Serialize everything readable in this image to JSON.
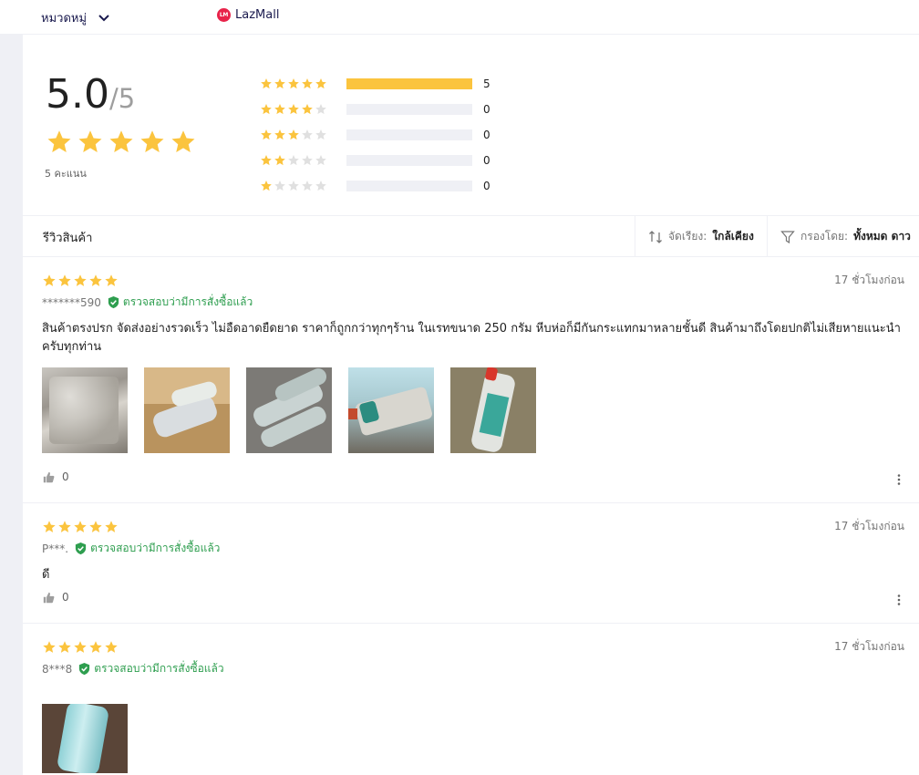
{
  "topbar": {
    "category_label": "หมวดหมู่",
    "lazmall_badge": "LM",
    "lazmall_label": "LazMall"
  },
  "summary": {
    "average": "5.0",
    "out_of": "/5",
    "rating_count": "5 คะแนน",
    "distribution": [
      {
        "stars": 5,
        "count": "5",
        "fraction": 1.0
      },
      {
        "stars": 4,
        "count": "0",
        "fraction": 0
      },
      {
        "stars": 3,
        "count": "0",
        "fraction": 0
      },
      {
        "stars": 2,
        "count": "0",
        "fraction": 0
      },
      {
        "stars": 1,
        "count": "0",
        "fraction": 0
      }
    ]
  },
  "reviews_header": {
    "title": "รีวิวสินค้า",
    "sort_label": "จัดเรียง:",
    "sort_value": "ใกล้เคียง",
    "filter_label": "กรองโดย:",
    "filter_value": "ทั้งหมด ดาว"
  },
  "reviews": [
    {
      "stars": 5,
      "author": "*******590",
      "verified": "ตรวจสอบว่ามีการสั่งซื้อแล้ว",
      "time": "17 ชั่วโมงก่อน",
      "text": "สินค้าตรงปรก จัดส่งอย่างรวดเร็ว ไม่อืดอาดยืดยาด  ราคาก็ถูกกว่าทุกๆร้าน ในเรทขนาด 250 กรัม หีบห่อก็มีกันกระแทกมาหลายชั้นดี สินค้ามาถึงโดยปกติไม่เสียหายแนะนำครับทุกท่าน",
      "likes": "0",
      "image_count": 5
    },
    {
      "stars": 5,
      "author": "P***.",
      "verified": "ตรวจสอบว่ามีการสั่งซื้อแล้ว",
      "time": "17 ชั่วโมงก่อน",
      "text": "ดี",
      "likes": "0",
      "image_count": 0
    },
    {
      "stars": 5,
      "author": "8***8",
      "verified": "ตรวจสอบว่ามีการสั่งซื้อแล้ว",
      "time": "17 ชั่วโมงก่อน",
      "text": "",
      "likes": "",
      "image_count": 1
    }
  ],
  "colors": {
    "star": "#fbc43e",
    "star_empty": "#e0e0e0",
    "verified": "#2e9e4f",
    "lazmall": "#e8234a"
  }
}
